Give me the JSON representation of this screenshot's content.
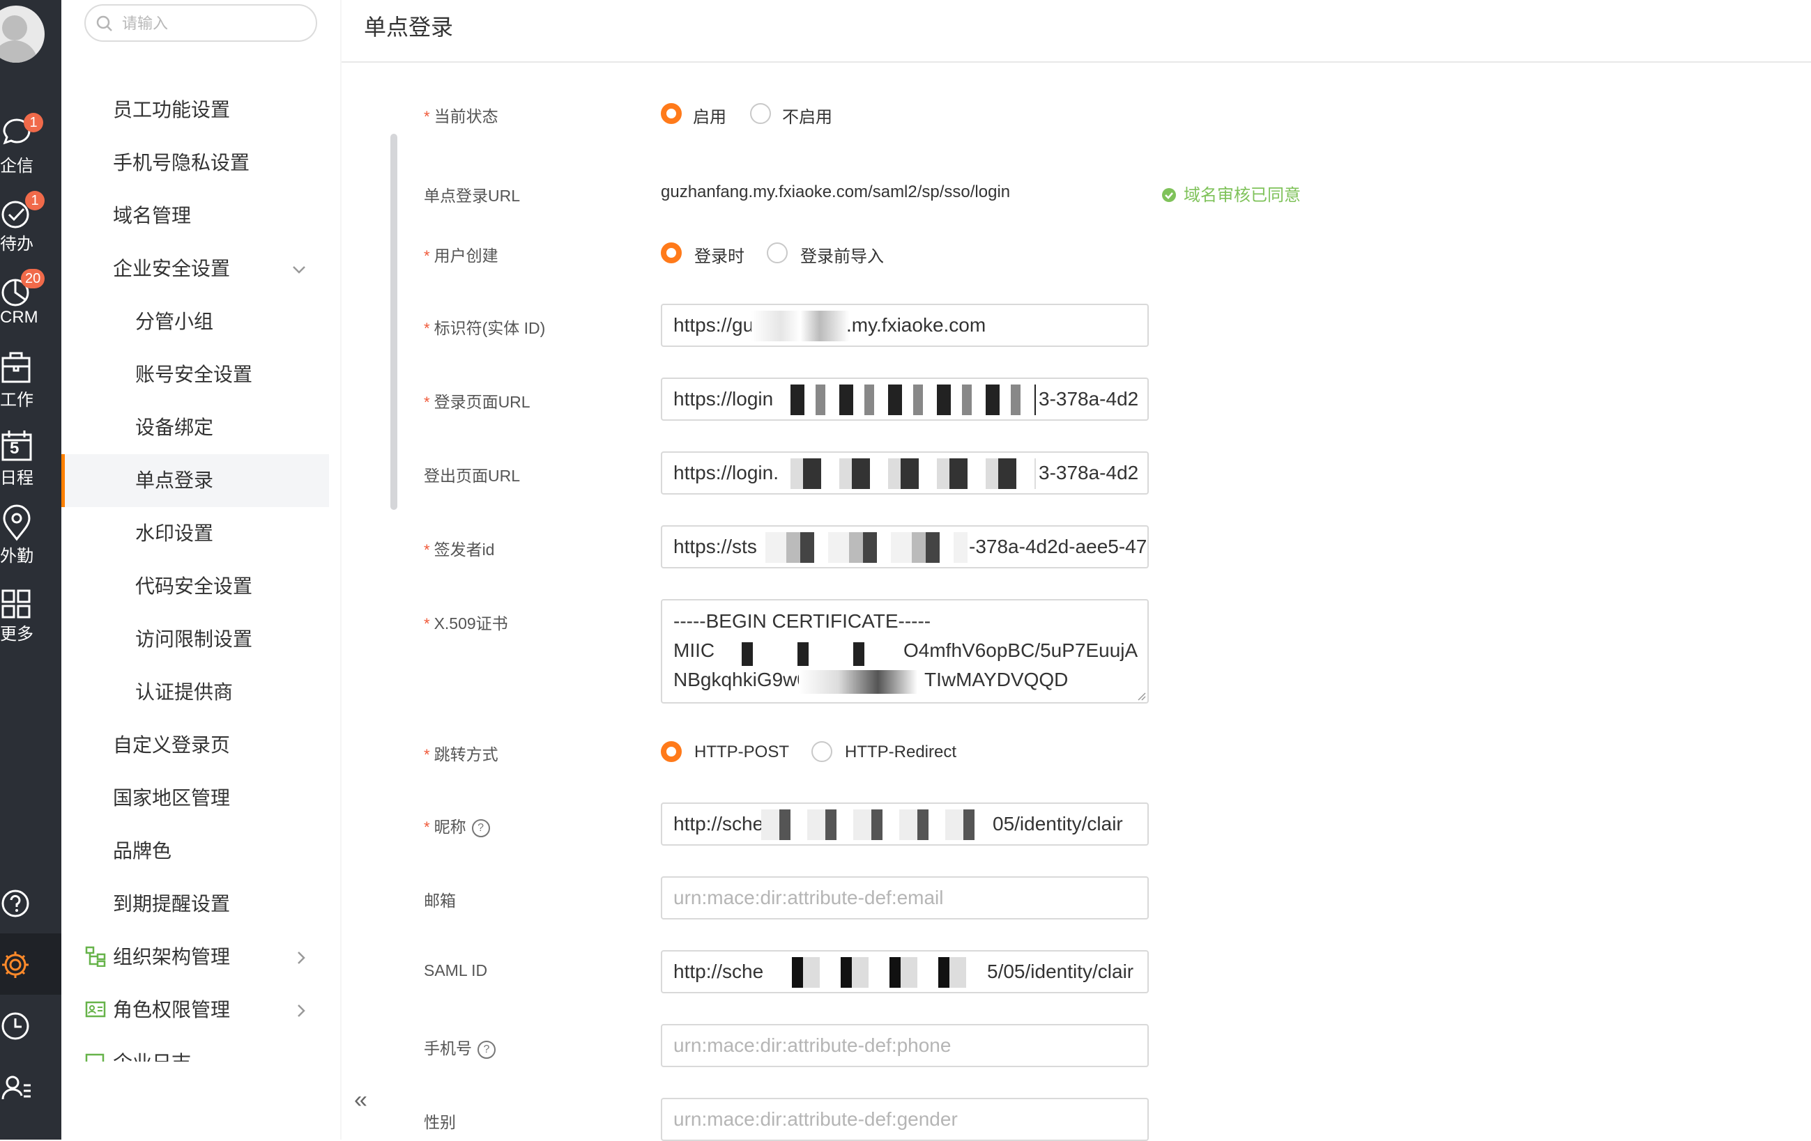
{
  "rail": {
    "items": [
      {
        "label": "企信",
        "badge": "1"
      },
      {
        "label": "待办",
        "badge": "1"
      },
      {
        "label": "CRM",
        "badge": "20"
      },
      {
        "label": "工作"
      },
      {
        "label": "日程",
        "calendar_day": "5"
      },
      {
        "label": "外勤"
      },
      {
        "label": "更多"
      }
    ]
  },
  "menu": {
    "search_placeholder": "请输入",
    "items": [
      {
        "label": "员工功能设置",
        "level": 1
      },
      {
        "label": "手机号隐私设置",
        "level": 1
      },
      {
        "label": "域名管理",
        "level": 1
      },
      {
        "label": "企业安全设置",
        "level": 1,
        "expanded": true
      },
      {
        "label": "分管小组",
        "level": 2
      },
      {
        "label": "账号安全设置",
        "level": 2
      },
      {
        "label": "设备绑定",
        "level": 2
      },
      {
        "label": "单点登录",
        "level": 2,
        "active": true
      },
      {
        "label": "水印设置",
        "level": 2
      },
      {
        "label": "代码安全设置",
        "level": 2
      },
      {
        "label": "访问限制设置",
        "level": 2
      },
      {
        "label": "认证提供商",
        "level": 2
      },
      {
        "label": "自定义登录页",
        "level": 1
      },
      {
        "label": "国家地区管理",
        "level": 1
      },
      {
        "label": "品牌色",
        "level": 1
      },
      {
        "label": "到期提醒设置",
        "level": 1
      },
      {
        "label": "组织架构管理",
        "level": 1
      },
      {
        "label": "角色权限管理",
        "level": 1
      },
      {
        "label": "企业日志",
        "level": 1
      }
    ],
    "collapse_glyph": "«"
  },
  "page": {
    "title": "单点登录"
  },
  "form": {
    "status": {
      "label": "当前状态",
      "options": [
        "启用",
        "不启用"
      ],
      "selected": "启用"
    },
    "sso_url": {
      "label": "单点登录URL",
      "value": "guzhanfang.my.fxiaoke.com/saml2/sp/sso/login",
      "approved_text": "域名审核已同意"
    },
    "user_creation": {
      "label": "用户创建",
      "options": [
        "登录时",
        "登录前导入"
      ],
      "selected": "登录时"
    },
    "entity_id": {
      "label": "标识符(实体 ID)",
      "value_start": "https://gu",
      "value_end": ".my.fxiaoke.com"
    },
    "login_url": {
      "label": "登录页面URL",
      "value_start": "https://login",
      "value_end": "3-378a-4d2"
    },
    "logout_url": {
      "label": "登出页面URL",
      "value_start": "https://login.",
      "value_end": "3-378a-4d2"
    },
    "issuer_id": {
      "label": "签发者id",
      "value_start": "https://sts",
      "value_end": "-378a-4d2d-aee5-47"
    },
    "x509": {
      "label": "X.509证书",
      "line1": "-----BEGIN CERTIFICATE-----",
      "line2_start": "MIIC",
      "line2_end": "O4mfhV6opBC/5uP7EuujA",
      "line3_start": "NBgkqhkiG9w0BA",
      "line3_end": "TIwMAYDVQQD"
    },
    "redirect": {
      "label": "跳转方式",
      "options": [
        "HTTP-POST",
        "HTTP-Redirect"
      ],
      "selected": "HTTP-POST"
    },
    "nickname": {
      "label": "昵称",
      "value_start": "http://sche",
      "value_end": "05/identity/clair"
    },
    "email": {
      "label": "邮箱",
      "placeholder": "urn:mace:dir:attribute-def:email"
    },
    "saml_id": {
      "label": "SAML ID",
      "value_start": "http://sche",
      "value_end": "5/05/identity/clair"
    },
    "phone": {
      "label": "手机号",
      "placeholder": "urn:mace:dir:attribute-def:phone"
    },
    "gender": {
      "label": "性别",
      "placeholder": "urn:mace:dir:attribute-def:gender"
    }
  }
}
